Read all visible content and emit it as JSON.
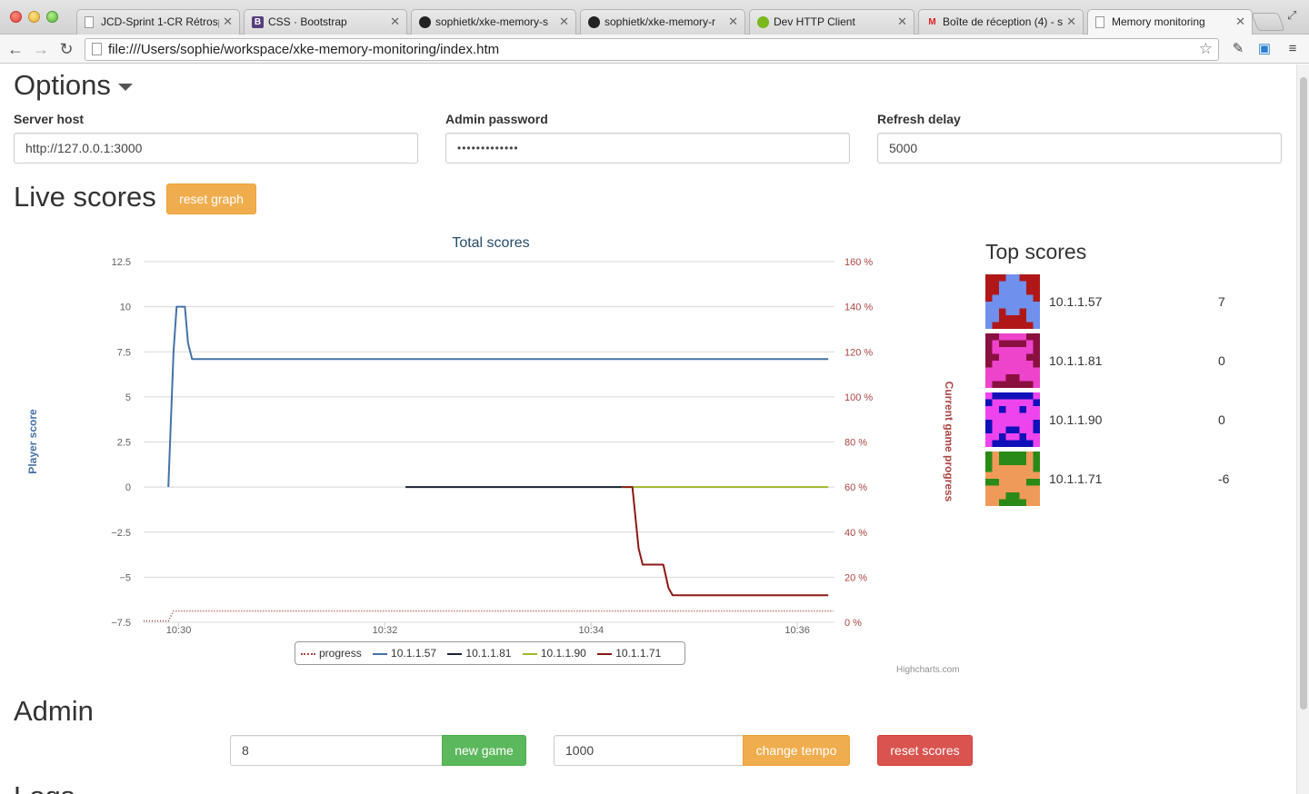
{
  "browser": {
    "tabs": [
      {
        "title": "JCD-Sprint 1-CR Rétrosp",
        "icon": "page-icon"
      },
      {
        "title": "CSS · Bootstrap",
        "icon": "bootstrap-icon"
      },
      {
        "title": "sophietk/xke-memory-s",
        "icon": "github-icon"
      },
      {
        "title": "sophietk/xke-memory-r",
        "icon": "github-icon"
      },
      {
        "title": "Dev HTTP Client",
        "icon": "dev-http-icon"
      },
      {
        "title": "Boîte de réception (4) - s",
        "icon": "gmail-icon"
      },
      {
        "title": "Memory monitoring",
        "icon": "page-icon"
      }
    ],
    "url": "file:///Users/sophie/workspace/xke-memory-monitoring/index.htm"
  },
  "options": {
    "title": "Options",
    "server_host_label": "Server host",
    "server_host_value": "http://127.0.0.1:3000",
    "admin_password_label": "Admin password",
    "admin_password_value": "•••••••••••••",
    "refresh_delay_label": "Refresh delay",
    "refresh_delay_value": "5000"
  },
  "live_scores": {
    "title": "Live scores",
    "reset_graph_label": "reset graph"
  },
  "chart_data": {
    "type": "line",
    "title": "Total scores",
    "ylabel": "Player score",
    "y2label": "Current game progress",
    "ylim": [
      -7.5,
      12.5
    ],
    "y2lim": [
      0,
      160
    ],
    "yticks": [
      "12.5",
      "10",
      "7.5",
      "5",
      "2.5",
      "0",
      "−2.5",
      "−5",
      "−7.5"
    ],
    "y2ticks": [
      "160 %",
      "140 %",
      "120 %",
      "100 %",
      "80 %",
      "60 %",
      "40 %",
      "20 %",
      "0 %"
    ],
    "xticks": [
      "10:30",
      "10:32",
      "10:34",
      "10:36"
    ],
    "xlim_minutes": [
      29.66,
      36.36
    ],
    "series": [
      {
        "name": "progress",
        "color": "#aa4643",
        "dash": true,
        "axis": "right",
        "points": [
          [
            29.66,
            0.6
          ],
          [
            29.9,
            0.6
          ],
          [
            29.95,
            5
          ],
          [
            36.35,
            5
          ]
        ]
      },
      {
        "name": "10.1.1.57",
        "color": "#4572a7",
        "points": [
          [
            29.9,
            0
          ],
          [
            29.95,
            7.5
          ],
          [
            29.98,
            10
          ],
          [
            30.06,
            10
          ],
          [
            30.09,
            8
          ],
          [
            30.13,
            7.1
          ],
          [
            36.3,
            7.1
          ]
        ]
      },
      {
        "name": "10.1.1.81",
        "color": "#1a2234",
        "points": [
          [
            32.2,
            0
          ],
          [
            34.3,
            0
          ]
        ]
      },
      {
        "name": "10.1.1.90",
        "color": "#a0b82a",
        "points": [
          [
            34.3,
            0
          ],
          [
            36.3,
            0
          ]
        ]
      },
      {
        "name": "10.1.1.71",
        "color": "#8b1a14",
        "points": [
          [
            34.3,
            0
          ],
          [
            34.4,
            0
          ],
          [
            34.46,
            -3.4
          ],
          [
            34.5,
            -4.3
          ],
          [
            34.7,
            -4.3
          ],
          [
            34.75,
            -5.6
          ],
          [
            34.79,
            -6.0
          ],
          [
            36.3,
            -6.0
          ]
        ]
      }
    ],
    "credits": "Highcharts.com"
  },
  "top_scores": {
    "title": "Top scores",
    "rows": [
      {
        "ip": "10.1.1.57",
        "score": "7",
        "bg": "#b01818",
        "fg": "#7090ee"
      },
      {
        "ip": "10.1.1.81",
        "score": "0",
        "bg": "#8a1040",
        "fg": "#ee44cc"
      },
      {
        "ip": "10.1.1.90",
        "score": "0",
        "bg": "#1010b8",
        "fg": "#ee44ee"
      },
      {
        "ip": "10.1.1.71",
        "score": "-6",
        "bg": "#2a8a18",
        "fg": "#f09a5a"
      }
    ]
  },
  "admin": {
    "title": "Admin",
    "pairs_value": "8",
    "new_game_label": "new game",
    "tempo_value": "1000",
    "change_tempo_label": "change tempo",
    "reset_scores_label": "reset scores"
  },
  "next_section_title": "Logs"
}
